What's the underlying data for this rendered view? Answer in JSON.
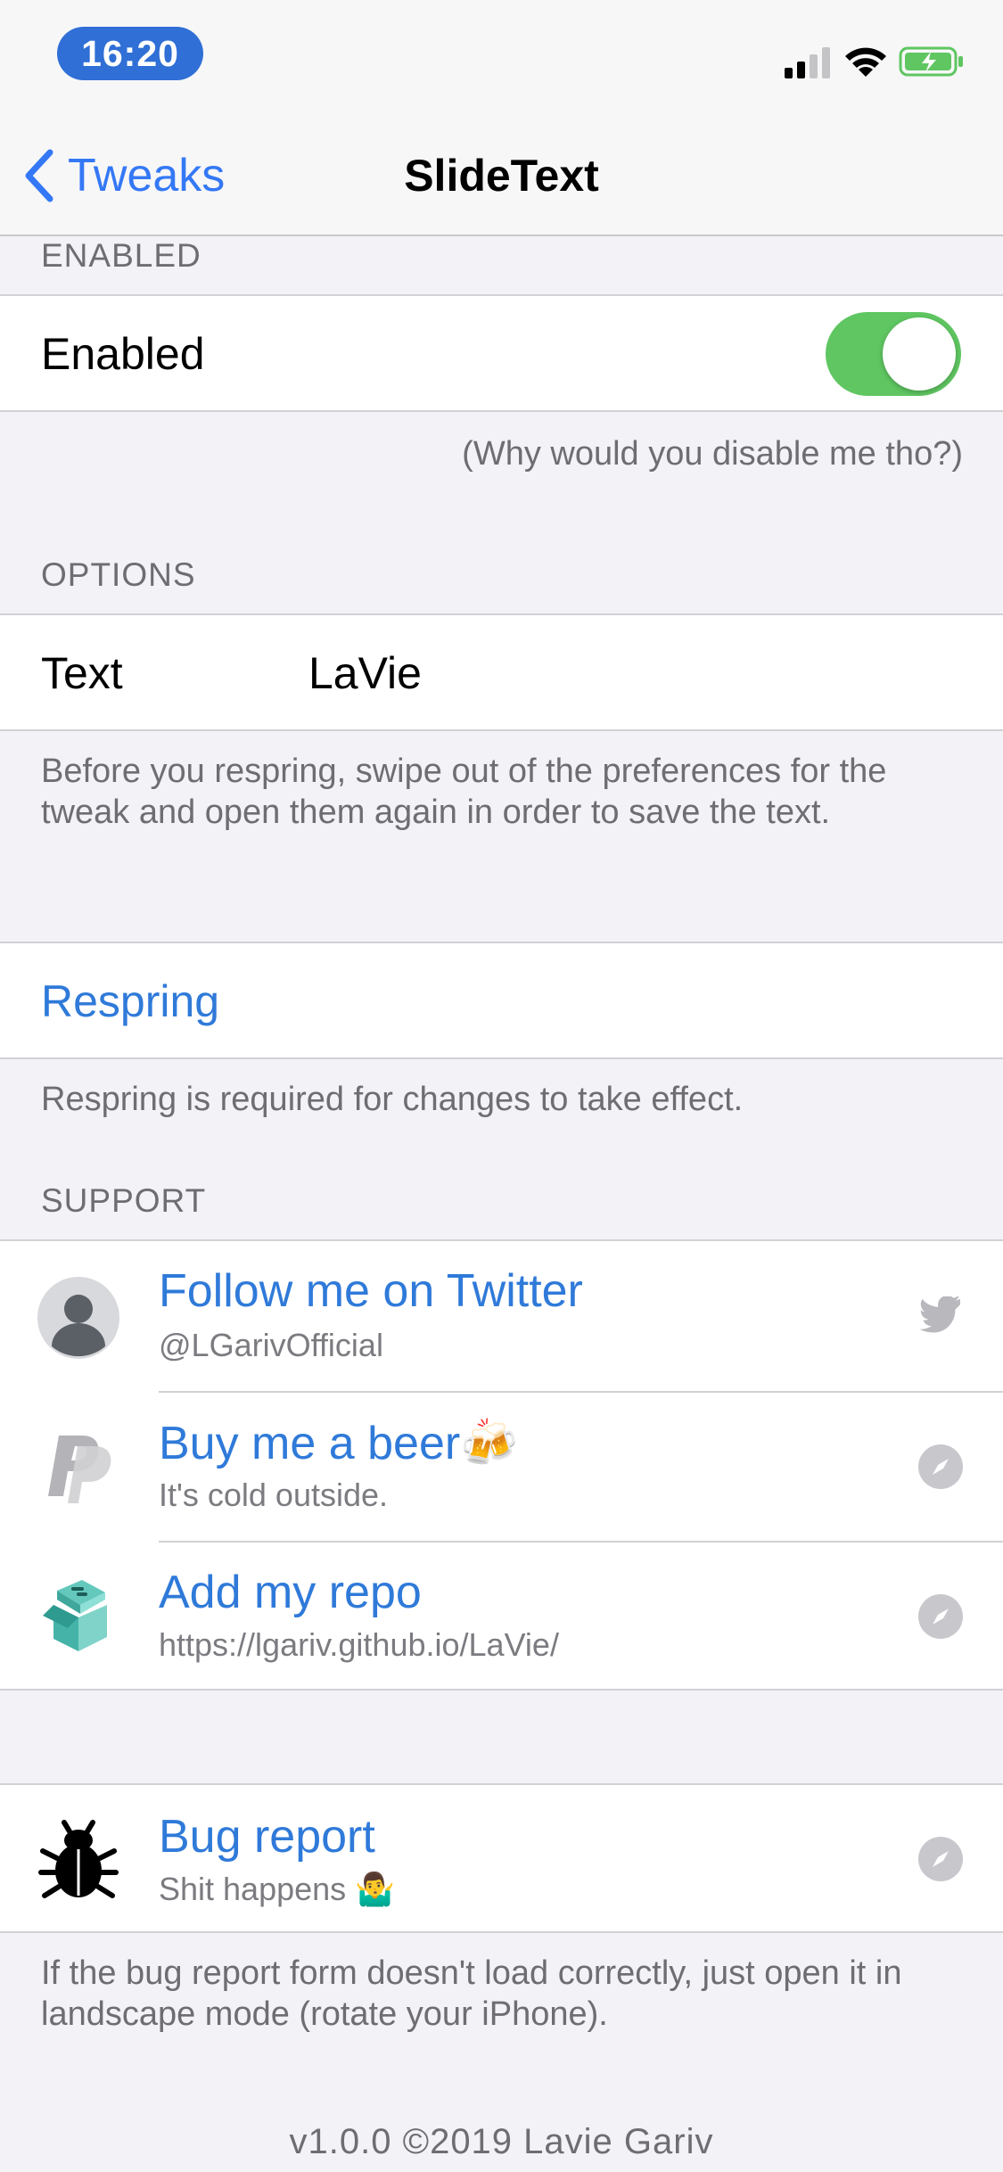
{
  "status_bar": {
    "time": "16:20"
  },
  "nav": {
    "back_label": "Tweaks",
    "title": "SlideText"
  },
  "enabled_section": {
    "header": "ENABLED",
    "toggle_label": "Enabled",
    "toggle_on": true,
    "footer": "(Why would you disable me tho?)"
  },
  "options_section": {
    "header": "OPTIONS",
    "text_label": "Text",
    "text_value": "LaVie",
    "footer": "Before you respring, swipe out of the preferences for the tweak and open them again in order to save the text."
  },
  "respring": {
    "label": "Respring",
    "footer": "Respring is required for changes to take effect."
  },
  "support_section": {
    "header": "SUPPORT",
    "items": [
      {
        "title": "Follow me on Twitter",
        "subtitle": "@LGarivOfficial",
        "icon": "avatar-icon",
        "accessory": "twitter-icon"
      },
      {
        "title": "Buy me a beer🍻",
        "subtitle": "It's cold outside.",
        "icon": "paypal-icon",
        "accessory": "safari-compass-icon"
      },
      {
        "title": "Add my repo",
        "subtitle": "https://lgariv.github.io/LaVie/",
        "icon": "package-box-icon",
        "accessory": "safari-compass-icon"
      }
    ]
  },
  "bug_section": {
    "title": "Bug report",
    "subtitle": "Shit happens 🤷‍♂️",
    "icon": "bug-icon",
    "accessory": "safari-compass-icon",
    "footer": "If the bug report form doesn't load correctly, just open it in landscape mode (rotate your iPhone)."
  },
  "version": "v1.0.0 ©2019 Lavie Gariv",
  "colors": {
    "accent": "#2f7ad9",
    "toggle_on": "#5fc661",
    "time_pill": "#2f6fd6",
    "background": "#f2f2f7"
  }
}
